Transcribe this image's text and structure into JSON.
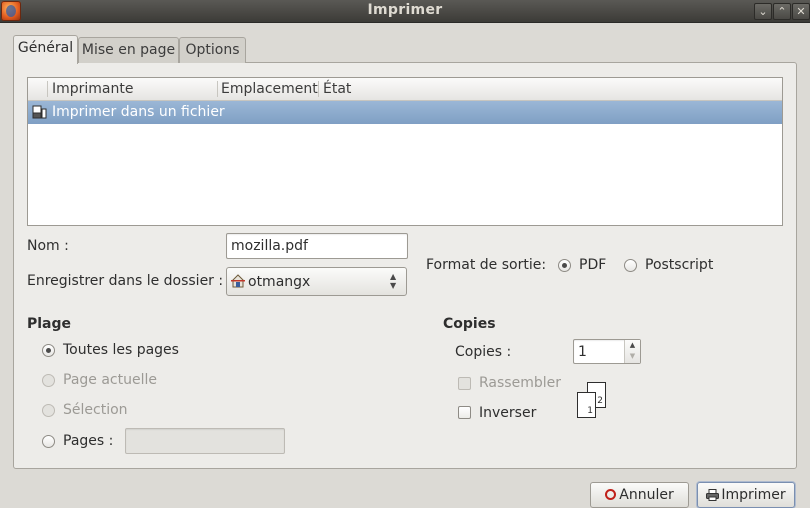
{
  "window": {
    "title": "Imprimer"
  },
  "tabs": [
    {
      "label": "Général"
    },
    {
      "label": "Mise en page"
    },
    {
      "label": "Options"
    }
  ],
  "printer_list": {
    "columns": [
      "Imprimante",
      "Emplacement",
      "État"
    ],
    "rows": [
      {
        "name": "Imprimer dans un fichier",
        "location": "",
        "status": ""
      }
    ]
  },
  "file": {
    "name_label": "Nom :",
    "name_value": "mozilla.pdf",
    "folder_label": "Enregistrer dans le dossier :",
    "folder_value": "otmangx",
    "format_label": "Format de sortie:",
    "format_options": [
      "PDF",
      "Postscript"
    ],
    "format_selected": "PDF"
  },
  "range": {
    "title": "Plage",
    "options": [
      "Toutes les pages",
      "Page actuelle",
      "Sélection",
      "Pages :"
    ],
    "selected": "Toutes les pages",
    "pages_value": ""
  },
  "copies": {
    "title": "Copies",
    "copies_label": "Copies :",
    "copies_value": "1",
    "collate_label": "Rassembler",
    "reverse_label": "Inverser",
    "collate_icon_pages": [
      "1",
      "2"
    ]
  },
  "buttons": {
    "cancel": "Annuler",
    "print": "Imprimer"
  }
}
